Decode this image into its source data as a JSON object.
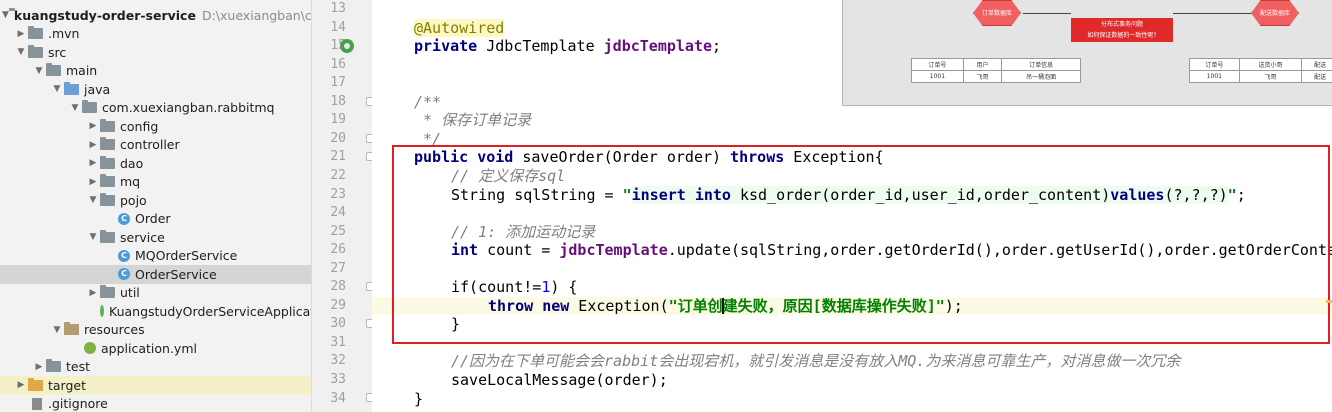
{
  "project_tree": {
    "project_name": "kuangstudy-order-service",
    "project_path": "D:\\xuexiangban\\courses",
    "items": [
      {
        "label": ".mvn"
      },
      {
        "label": "src"
      },
      {
        "label": "main"
      },
      {
        "label": "java"
      },
      {
        "label": "com.xuexiangban.rabbitmq"
      },
      {
        "label": "config"
      },
      {
        "label": "controller"
      },
      {
        "label": "dao"
      },
      {
        "label": "mq"
      },
      {
        "label": "pojo"
      },
      {
        "label": "Order"
      },
      {
        "label": "service"
      },
      {
        "label": "MQOrderService"
      },
      {
        "label": "OrderService"
      },
      {
        "label": "util"
      },
      {
        "label": "KuangstudyOrderServiceApplication"
      },
      {
        "label": "resources"
      },
      {
        "label": "application.yml"
      },
      {
        "label": "test"
      },
      {
        "label": "target"
      },
      {
        "label": ".gitignore"
      }
    ],
    "class_icon_letter": "C"
  },
  "editor": {
    "line_numbers": [
      "13",
      "14",
      "15",
      "16",
      "17",
      "18",
      "19",
      "20",
      "21",
      "22",
      "23",
      "24",
      "25",
      "26",
      "27",
      "28",
      "29",
      "30",
      "31",
      "32",
      "33",
      "34"
    ],
    "tokens": {
      "l14_annotation": "@Autowired",
      "l15_private": "private",
      "l15_type": " JdbcTemplate ",
      "l15_field": "jdbcTemplate",
      "l15_semi": ";",
      "l18_doc": "/**",
      "l19_doc": " * 保存订单记录",
      "l20_doc": " */",
      "l21_public": "public",
      "l21_void": "void",
      "l21_sig": " saveOrder(Order order) ",
      "l21_throws": "throws",
      "l21_tail": " Exception{",
      "l22_comment": "// 定义保存sql",
      "l23_decl": "String sqlString = ",
      "l23_q1": "\"",
      "l23_insert": "insert",
      "l23_sp1": " ",
      "l23_into": "into",
      "l23_table": " ksd_order(order_id,user_id,order_content)",
      "l23_values": "values",
      "l23_params": "(?,?,?)",
      "l23_q2": "\"",
      "l23_end": ";",
      "l25_comment": "// 1: 添加运动记录",
      "l26_int": "int",
      "l26_count": " count = ",
      "l26_field": "jdbcTemplate",
      "l26_rest": ".update(sqlString,order.getOrderId(),order.getUserId(),order.getOrderContent());",
      "l28_if": "if(count!=",
      "l28_num": "1",
      "l28_tail": ") {",
      "l29_throw": "throw",
      "l29_new": "new",
      "l29_exc": " Exception(",
      "l29_str_a": "\"订单创",
      "l29_str_b": "建失败，原因[数据库操作失败]\"",
      "l29_end": ");",
      "l30_brace": "}",
      "l32_comment": "//因为在下单可能会会rabbit会出现宕机，就引发消息是没有放入MQ.为来消息可靠生产，对消息做一次冗余",
      "l33_call": "saveLocalMessage(order);",
      "l34_brace": "}"
    }
  },
  "diagram": {
    "left_db": "订单数据库",
    "right_db": "配送数据库",
    "center_line1": "分布式事务问题",
    "center_line2": "如何保证数据的一致性呢?",
    "left_table": {
      "headers": [
        "订单号",
        "用户",
        "订单信息"
      ],
      "row": [
        "1001",
        "飞哥",
        "吊一桶泡面"
      ]
    },
    "right_table": {
      "headers": [
        "订单号",
        "送货小哥",
        "配送"
      ],
      "row": [
        "1001",
        "飞哥",
        "配送"
      ]
    }
  },
  "colors": {
    "keyword": "#000080",
    "annotation": "#808000",
    "comment": "#808080",
    "string": "#008000",
    "field": "#660e7a",
    "highlight_box": "#e02020",
    "database": "#f06060"
  }
}
